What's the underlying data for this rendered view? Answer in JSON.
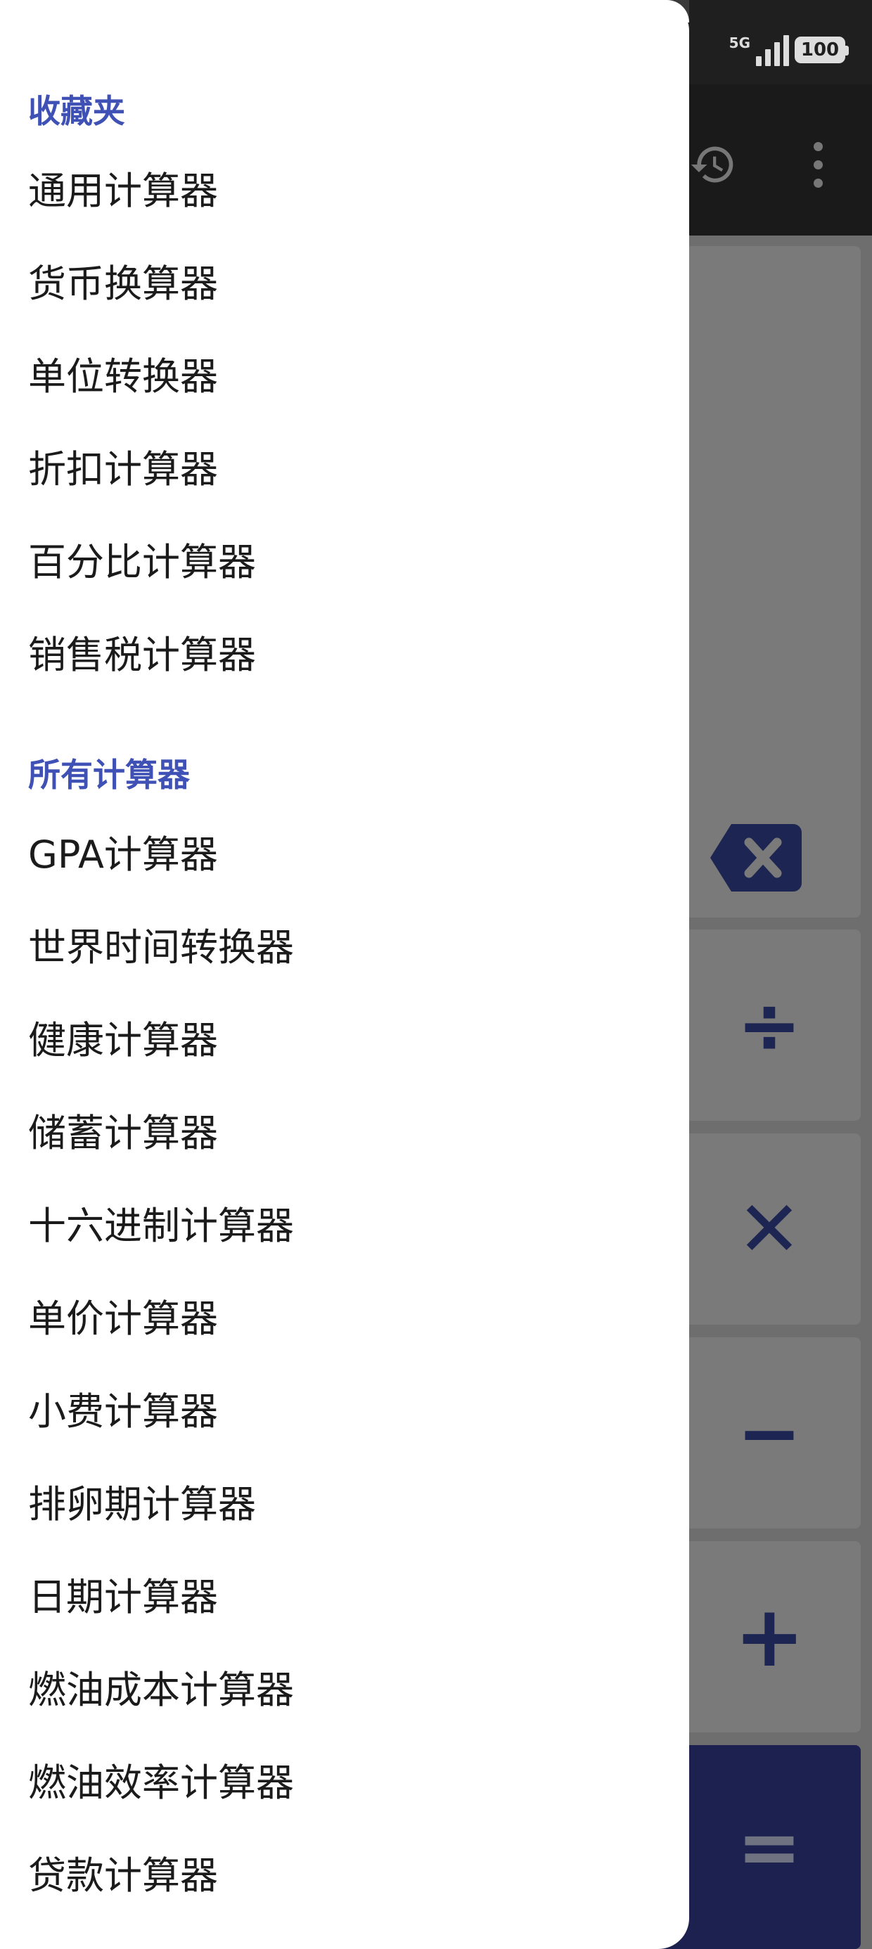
{
  "status_bar": {
    "network": "5G",
    "battery": "100"
  },
  "keypad": {
    "divide": "÷",
    "multiply": "✕",
    "subtract": "−",
    "add": "+",
    "equals": "="
  },
  "drawer": {
    "favorites_header": "收藏夹",
    "favorites": [
      "通用计算器",
      "货币换算器",
      "单位转换器",
      "折扣计算器",
      "百分比计算器",
      "销售税计算器"
    ],
    "all_header": "所有计算器",
    "all": [
      "GPA计算器",
      "世界时间转换器",
      "健康计算器",
      "储蓄计算器",
      "十六进制计算器",
      "单价计算器",
      "小费计算器",
      "排卵期计算器",
      "日期计算器",
      "燃油成本计算器",
      "燃油效率计算器",
      "贷款计算器"
    ]
  },
  "colors": {
    "accent": "#3f51b5",
    "key_symbol": "#1d2552",
    "equals_key": "#1c2150"
  }
}
